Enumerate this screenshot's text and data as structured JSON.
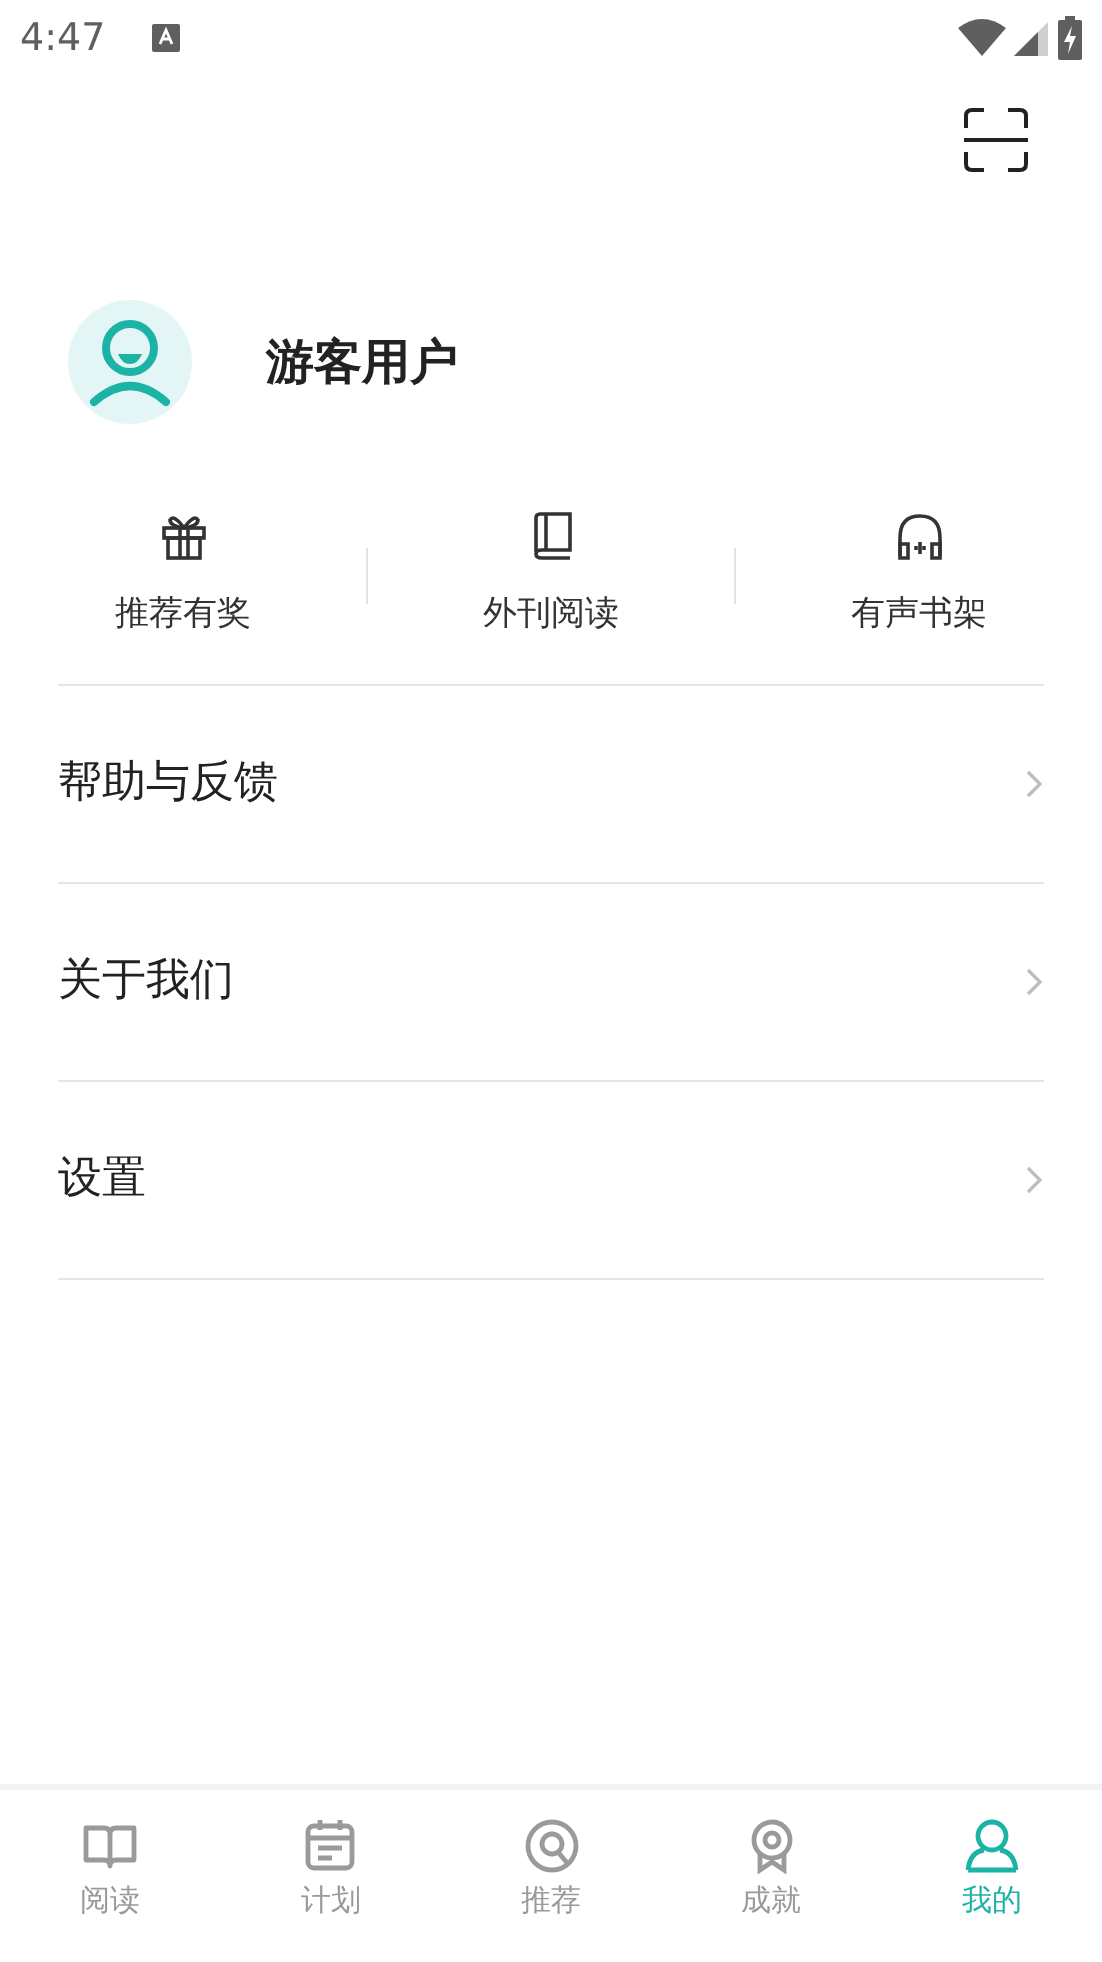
{
  "status_bar": {
    "time": "4:47"
  },
  "profile": {
    "name": "游客用户"
  },
  "shortcuts": [
    {
      "kind": "gift",
      "label": "推荐有奖"
    },
    {
      "kind": "book",
      "label": "外刊阅读"
    },
    {
      "kind": "headphones",
      "label": "有声书架"
    }
  ],
  "menu": [
    {
      "label": "帮助与反馈"
    },
    {
      "label": "关于我们"
    },
    {
      "label": "设置"
    }
  ],
  "tabs": [
    {
      "kind": "read",
      "label": "阅读",
      "selected": false
    },
    {
      "kind": "plan",
      "label": "计划",
      "selected": false
    },
    {
      "kind": "recommend",
      "label": "推荐",
      "selected": false
    },
    {
      "kind": "achievement",
      "label": "成就",
      "selected": false
    },
    {
      "kind": "me",
      "label": "我的",
      "selected": true
    }
  ]
}
